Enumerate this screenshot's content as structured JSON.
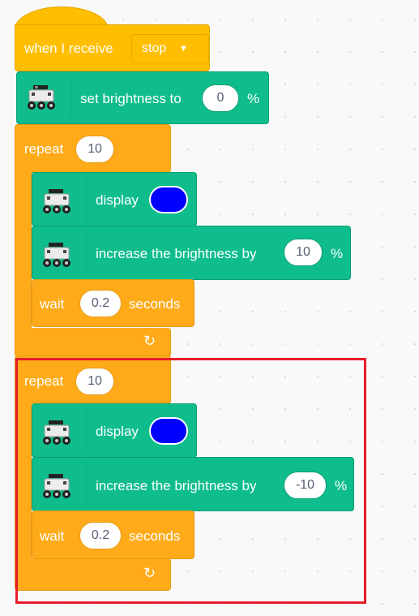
{
  "hat_block": {
    "label": "when I receive",
    "message": "stop",
    "dropdown_icon": "caret-down-icon"
  },
  "set_brightness": {
    "label": "set brightness to",
    "value": "0",
    "unit": "%",
    "icon": "robot-car-icon"
  },
  "repeat1": {
    "label": "repeat",
    "count": "10",
    "display": {
      "label": "display",
      "color": "#0000ff"
    },
    "increase": {
      "label": "increase the brightness by",
      "value": "10",
      "unit": "%"
    },
    "wait": {
      "label": "wait",
      "value": "0.2",
      "unit_label": "seconds"
    },
    "loop_icon": "loop-arrow-icon"
  },
  "repeat2": {
    "label": "repeat",
    "count": "10",
    "display": {
      "label": "display",
      "color": "#0000ff"
    },
    "increase": {
      "label": "increase the brightness by",
      "value": "-10",
      "unit": "%"
    },
    "wait": {
      "label": "wait",
      "value": "0.2",
      "unit_label": "seconds"
    },
    "loop_icon": "loop-arrow-icon"
  },
  "highlight_color": "#e81c2a",
  "colors": {
    "event": "#ffbf00",
    "control": "#ffab19",
    "extension": "#0fbd8c"
  }
}
